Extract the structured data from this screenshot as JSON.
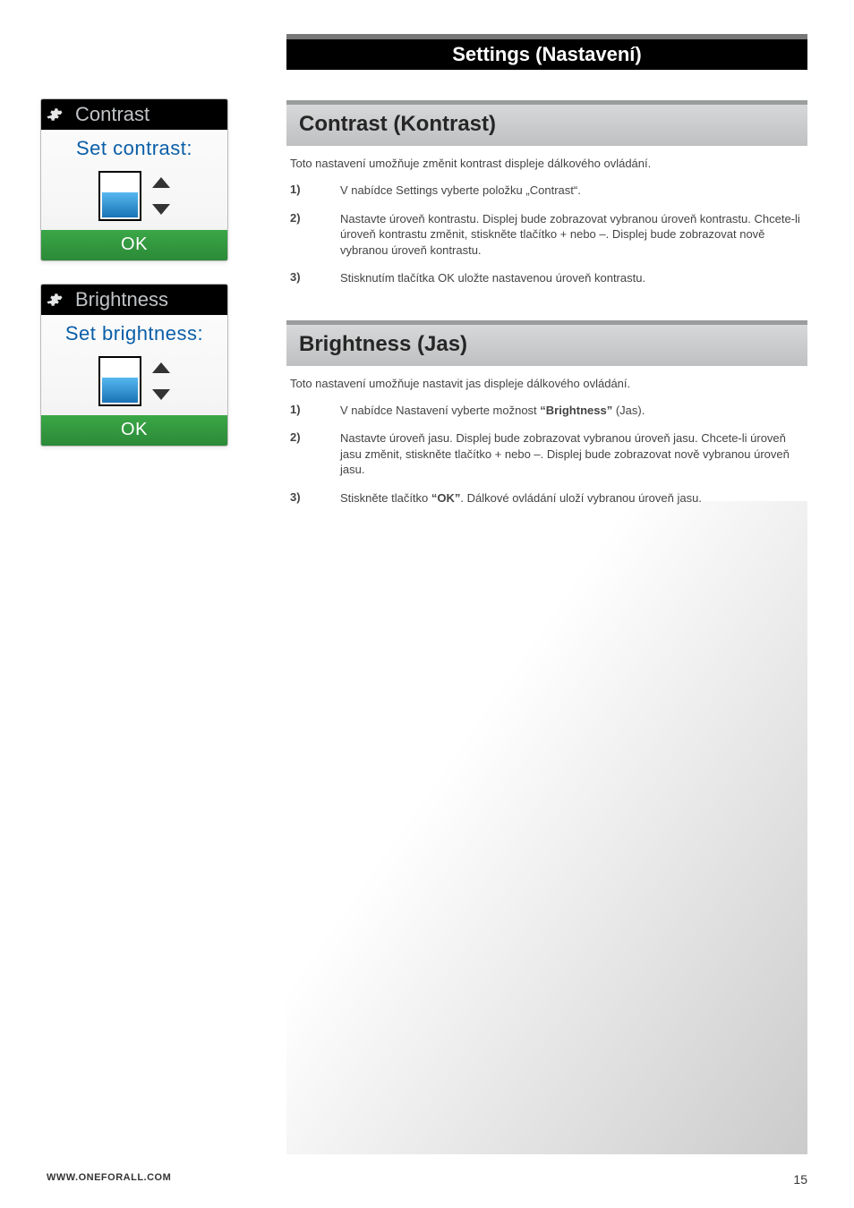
{
  "header": {
    "title": "Settings (Nastavení)"
  },
  "screens": {
    "contrast": {
      "title": "Contrast",
      "subtitle": "Set contrast:",
      "ok": "OK"
    },
    "brightness": {
      "title": "Brightness",
      "subtitle": "Set brightness:",
      "ok": "OK"
    }
  },
  "sections": {
    "contrast": {
      "heading": "Contrast (Kontrast)",
      "intro": "Toto nastavení umožňuje změnit kontrast displeje dálkového ovládání.",
      "steps": [
        {
          "n": "1)",
          "t": "V nabídce Settings vyberte položku „Contrast“."
        },
        {
          "n": "2)",
          "t": "Nastavte úroveň kontrastu. Displej bude zobrazovat vybranou úroveň kontrastu. Chcete-li úroveň kontrastu změnit, stiskněte tlačítko + nebo –. Displej bude zobrazovat nově vybranou úroveň kontrastu."
        },
        {
          "n": "3)",
          "t": "Stisknutím tlačítka OK uložte nastavenou úroveň kontrastu."
        }
      ]
    },
    "brightness": {
      "heading": "Brightness (Jas)",
      "intro": "Toto nastavení umožňuje nastavit jas displeje dálkového ovládání.",
      "steps": [
        {
          "n": "1)",
          "pre": "V nabídce Nastavení vyberte možnost ",
          "bold": "“Brightness”",
          "post": " (Jas)."
        },
        {
          "n": "2)",
          "t": "Nastavte úroveň jasu. Displej bude zobrazovat vybranou úroveň jasu. Chcete-li úroveň jasu změnit, stiskněte tlačítko + nebo –. Displej bude zobrazovat nově vybranou úroveň jasu."
        },
        {
          "n": "3)",
          "pre": "Stiskněte tlačítko ",
          "bold": "“OK”",
          "post": ". Dálkové ovládání uloží vybranou úroveň jasu."
        }
      ]
    }
  },
  "footer": {
    "url": "WWW.ONEFORALL.COM",
    "page": "15"
  }
}
